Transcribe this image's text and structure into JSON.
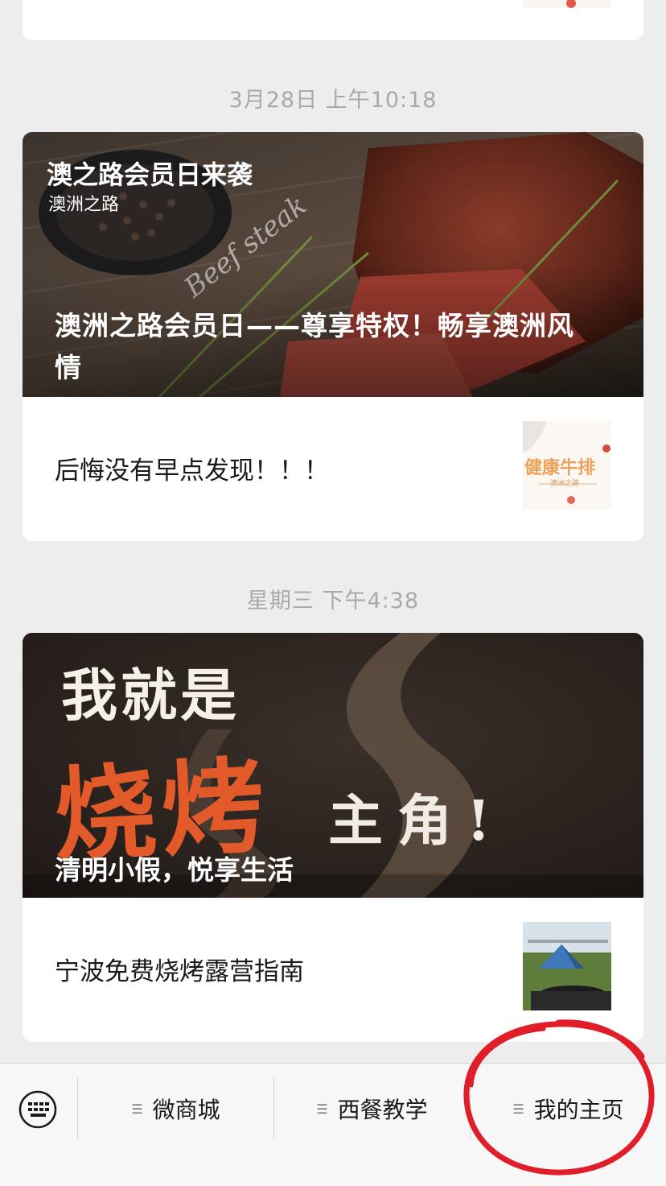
{
  "feed": {
    "groups": [
      {
        "timestamp": "3月28日 上午10:18",
        "cover": {
          "badge_title": "澳之路会员日来袭",
          "badge_source": "澳洲之路",
          "script_text": "Beef steak",
          "headline_line1": "澳洲之路会员日——尊享特权！畅享澳洲风",
          "headline_line2": "情"
        },
        "sub_article": {
          "title": "后悔没有早点发现！！！",
          "thumb_text": "健康牛排",
          "thumb_small": "澳洲之路"
        }
      },
      {
        "timestamp": "星期三 下午4:38",
        "cover": {
          "big_line1": "我就是",
          "big_red": "烧烤",
          "big_line3": "主角!",
          "headline": "清明小假，悦享生活"
        },
        "sub_article": {
          "title": "宁波免费烧烤露营指南"
        }
      }
    ]
  },
  "tabbar": {
    "keyboard_icon": "keyboard-icon",
    "tabs": [
      {
        "label": "微商城"
      },
      {
        "label": "西餐教学"
      },
      {
        "label": "我的主页"
      }
    ],
    "annotation_color": "#e01e2a"
  }
}
